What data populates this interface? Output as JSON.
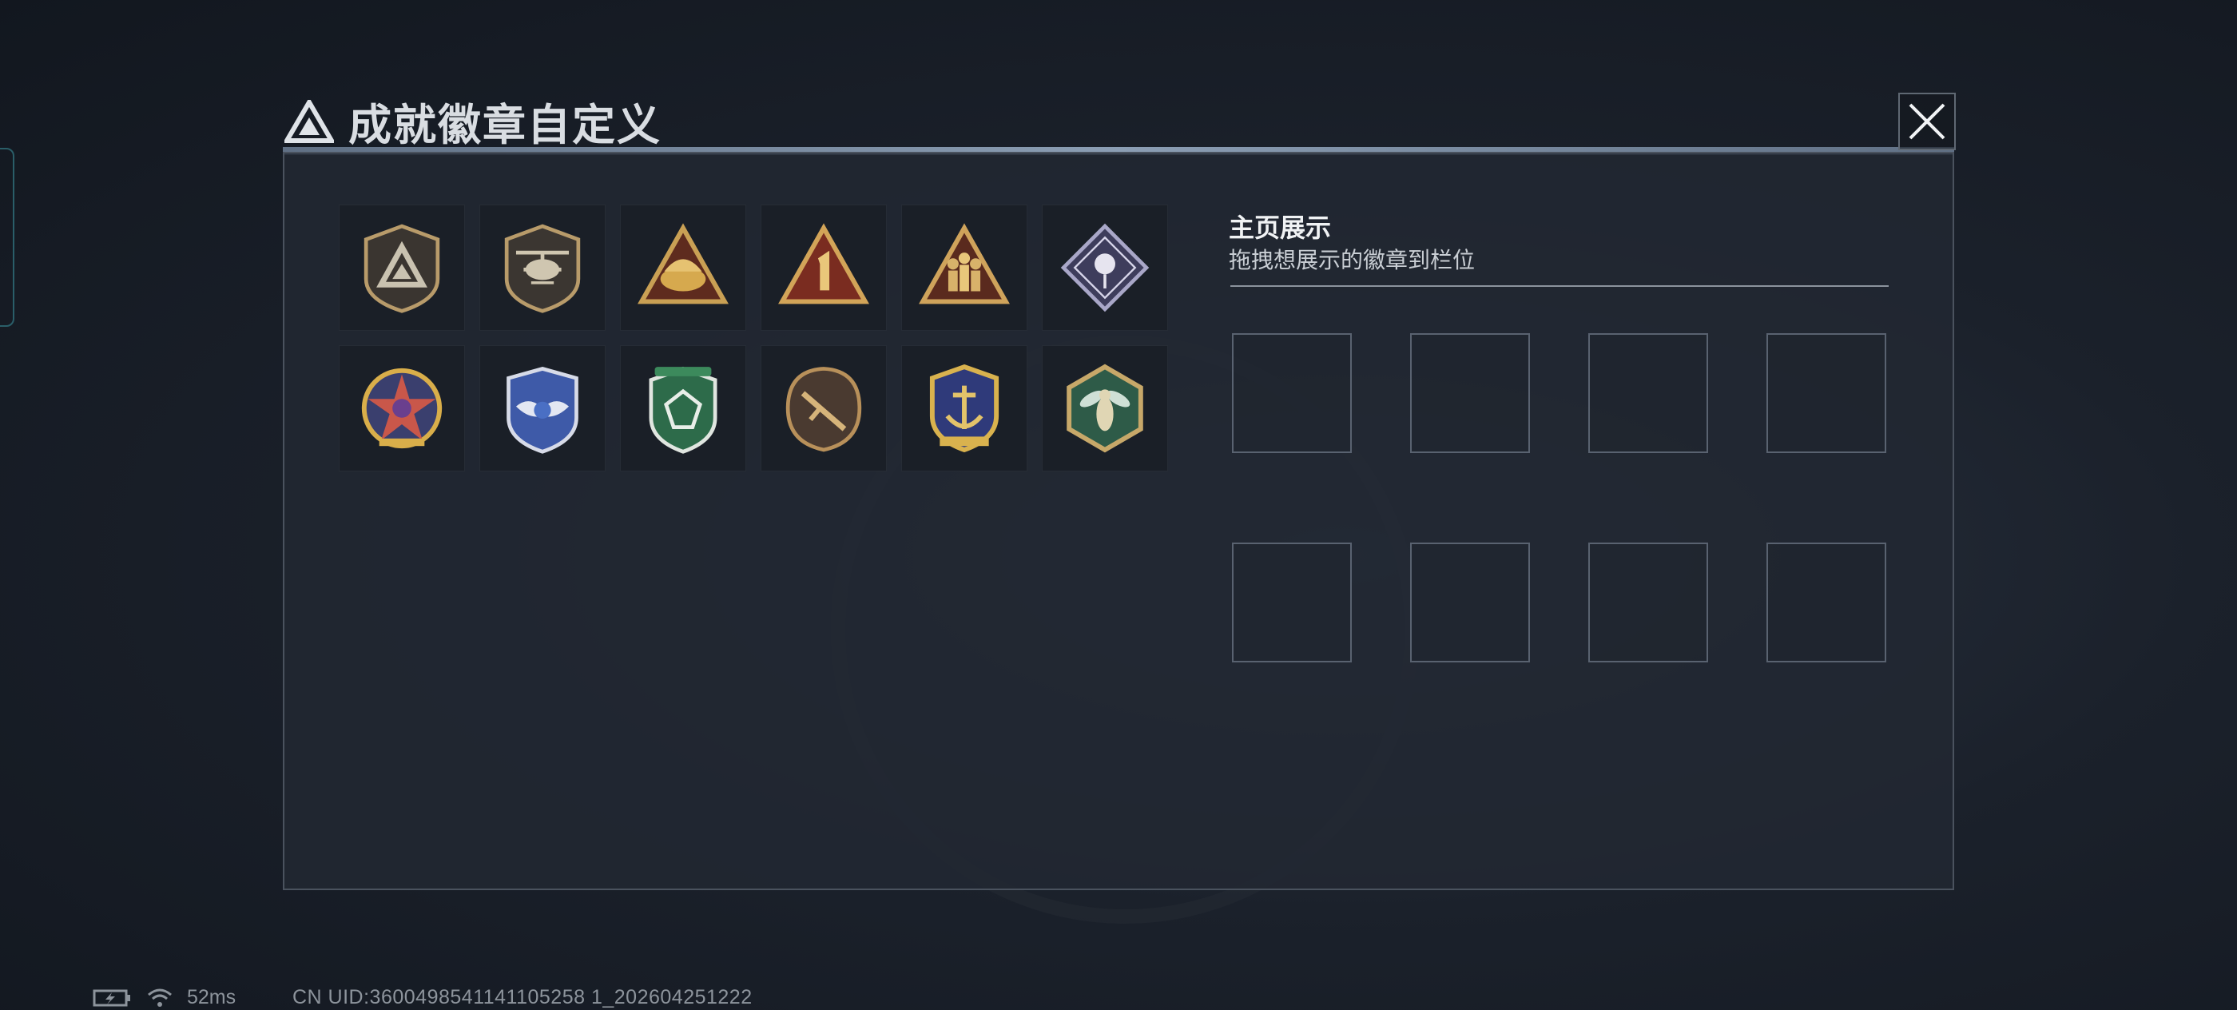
{
  "dialog": {
    "title": "成就徽章自定义",
    "close_icon": "close-icon"
  },
  "badges": [
    {
      "name": "triangle-shield-badge",
      "row": 1
    },
    {
      "name": "helicopter-shield-badge",
      "row": 1
    },
    {
      "name": "bread-triangle-badge",
      "row": 1
    },
    {
      "name": "number-one-triangle-badge",
      "row": 1
    },
    {
      "name": "soldiers-triangle-badge",
      "row": 1
    },
    {
      "name": "rose-diamond-badge",
      "row": 1
    },
    {
      "name": "star-crest-badge",
      "row": 2
    },
    {
      "name": "blue-wings-badge",
      "row": 2
    },
    {
      "name": "green-gem-shield-badge",
      "row": 2
    },
    {
      "name": "rifle-round-shield-badge",
      "row": 2
    },
    {
      "name": "gold-anchor-crest-badge",
      "row": 2
    },
    {
      "name": "wasp-hexagon-badge",
      "row": 2
    }
  ],
  "showcase": {
    "title": "主页展示",
    "subtitle": "拖拽想展示的徽章到栏位",
    "slot_count": 8
  },
  "status": {
    "ping": "52ms",
    "uid": "CN UID:3600498541141105258 1_202604251222"
  },
  "colors": {
    "panel_bg": "#222832",
    "accent_line": "#9fb4cc",
    "slot_border": "#596270"
  }
}
